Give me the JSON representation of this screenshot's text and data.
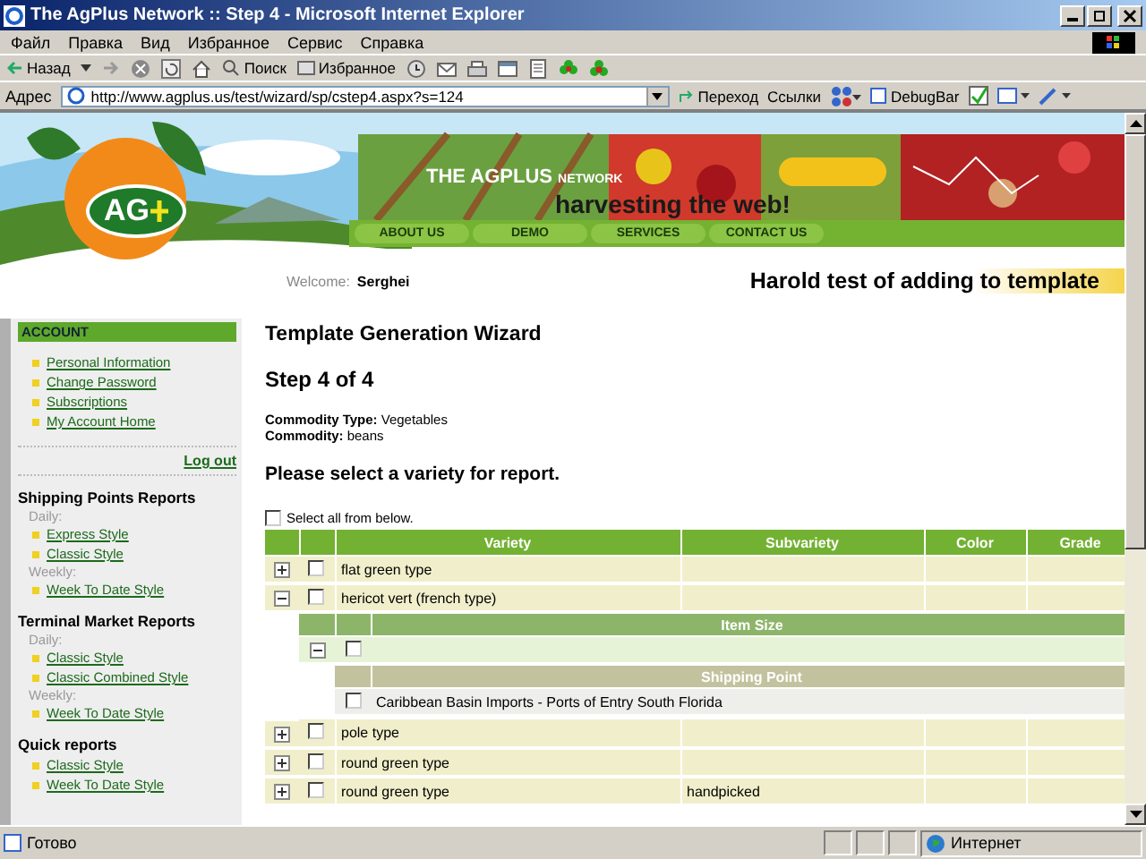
{
  "window": {
    "title": "The AgPlus Network :: Step 4 - Microsoft Internet Explorer"
  },
  "menu": [
    "Файл",
    "Правка",
    "Вид",
    "Избранное",
    "Сервис",
    "Справка"
  ],
  "toolbar": {
    "back": "Назад",
    "search": "Поиск",
    "favorites": "Избранное"
  },
  "address_bar": {
    "label": "Адрес",
    "url": "http://www.agplus.us/test/wizard/sp/cstep4.aspx?s=124",
    "go": "Переход",
    "links": "Ссылки",
    "debugbar": "DebugBar"
  },
  "banner": {
    "logo": "AG",
    "network_title": "THE AGPLUS",
    "network_suffix": "NETWORK",
    "tagline": "harvesting the web!",
    "nav": [
      "ABOUT US",
      "DEMO",
      "SERVICES",
      "CONTACT US"
    ],
    "welcome_label": "Welcome:",
    "user": "Serghei",
    "template_title": "Harold test of adding to template"
  },
  "sidebar": {
    "account": {
      "title": "ACCOUNT",
      "links": [
        "Personal Information",
        "Change Password",
        "Subscriptions",
        "My Account Home"
      ],
      "logout": "Log out"
    },
    "sections": [
      {
        "title": "Shipping Points Reports",
        "groups": [
          {
            "label": "Daily:",
            "links": [
              "Express Style",
              "Classic Style"
            ]
          },
          {
            "label": "Weekly:",
            "links": [
              "Week To Date Style"
            ]
          }
        ]
      },
      {
        "title": "Terminal Market Reports",
        "groups": [
          {
            "label": "Daily:",
            "links": [
              "Classic Style",
              "Classic Combined Style"
            ]
          },
          {
            "label": "Weekly:",
            "links": [
              "Week To Date Style"
            ]
          }
        ]
      },
      {
        "title": "Quick reports",
        "groups": [
          {
            "links": [
              "Classic Style",
              "Week To Date Style"
            ]
          }
        ]
      }
    ]
  },
  "main": {
    "title": "Template Generation Wizard",
    "step": "Step 4 of 4",
    "commodity_type_label": "Commodity Type:",
    "commodity_type": "Vegetables",
    "commodity_label": "Commodity:",
    "commodity": "beans",
    "prompt": "Please select a variety for report.",
    "select_all": {
      "label": "Select all from below.",
      "checked": false
    }
  },
  "table": {
    "columns": [
      "Variety",
      "Subvariety",
      "Color",
      "Grade"
    ],
    "rows": [
      {
        "variety": "flat green type",
        "expanded": false,
        "checked": false
      },
      {
        "variety": "hericot vert (french type)",
        "expanded": true,
        "checked": false,
        "item_size": {
          "header": "Item Size",
          "expanded": true,
          "checked": false,
          "shipping_header": "Shipping Point",
          "shipping_points": [
            {
              "name": "Caribbean Basin Imports - Ports of Entry South Florida",
              "checked": false
            }
          ]
        }
      },
      {
        "variety": "pole type",
        "expanded": false,
        "checked": false
      },
      {
        "variety": "round green type",
        "expanded": false,
        "checked": false
      },
      {
        "variety": "round green type",
        "subvariety": "handpicked",
        "expanded": false,
        "checked": false
      }
    ]
  },
  "status_bar": {
    "text": "Готово",
    "zone": "Интернет"
  }
}
